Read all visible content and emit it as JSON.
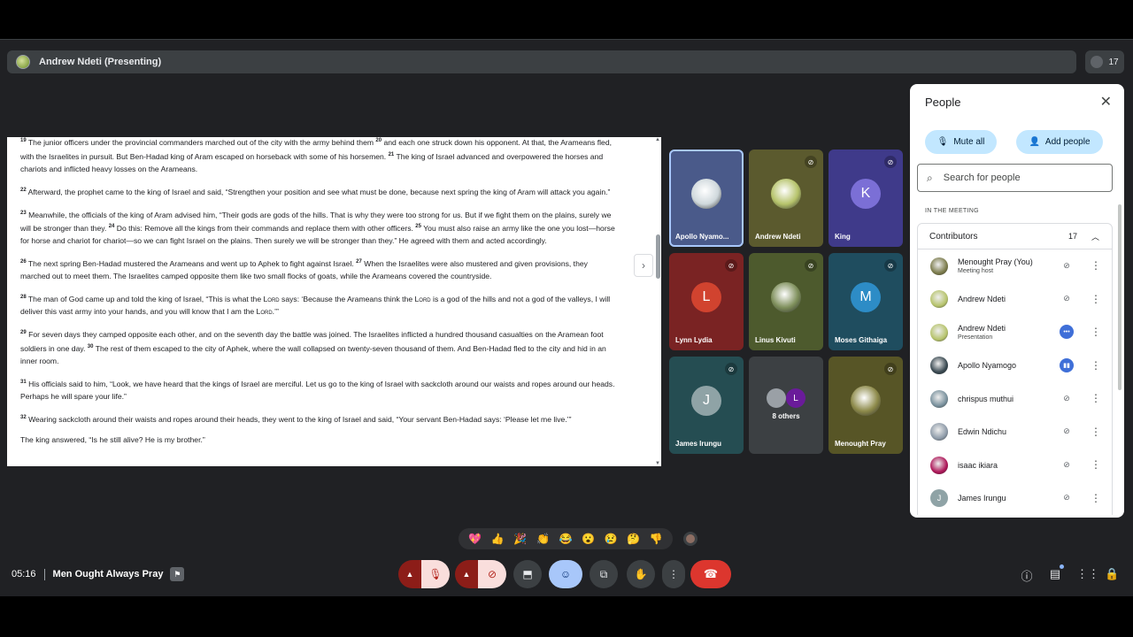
{
  "header": {
    "presenting_label": "Andrew Ndeti (Presenting)",
    "participant_count": "17"
  },
  "document": {
    "paragraphs": [
      {
        "html": "<sup>19</sup> The junior officers under the provincial commanders marched out of the city with the army behind them <sup>20</sup> and each one struck down his opponent. At that, the Arameans fled, with the Israelites in pursuit. But Ben-Hadad king of Aram escaped on horseback with some of his horsemen. <sup>21</sup> The king of Israel advanced and overpowered the horses and chariots and inflicted heavy losses on the Arameans."
      },
      {
        "html": "<sup>22</sup> Afterward, the prophet came to the king of Israel and said, “Strengthen your position and see what must be done, because next spring the king of Aram will attack you again.”"
      },
      {
        "html": "<sup>23</sup> Meanwhile, the officials of the king of Aram advised him, “Their gods are gods of the hills. That is why they were too strong for us. But if we fight them on the plains, surely we will be stronger than they. <sup>24</sup> Do this: Remove all the kings from their commands and replace them with other officers. <sup>25</sup> You must also raise an army like the one you lost—horse for horse and chariot for chariot—so we can fight Israel on the plains. Then surely we will be stronger than they.” He agreed with them and acted accordingly."
      },
      {
        "html": "<sup>26</sup> The next spring Ben-Hadad mustered the Arameans and went up to Aphek to fight against Israel. <sup>27</sup> When the Israelites were also mustered and given provisions, they marched out to meet them. The Israelites camped opposite them like two small flocks of goats, while the Arameans covered the countryside."
      },
      {
        "html": "<sup>28</sup> The man of God came up and told the king of Israel, “This is what the <span class=\"sc\">Lord</span> says: ‘Because the Arameans think the <span class=\"sc\">Lord</span> is a god of the hills and not a god of the valleys, I will deliver this vast army into your hands, and you will know that I am the <span class=\"sc\">Lord</span>.’”"
      },
      {
        "html": "<sup>29</sup> For seven days they camped opposite each other, and on the seventh day the battle was joined. The Israelites inflicted a hundred thousand casualties on the Aramean foot soldiers in one day. <sup>30</sup> The rest of them escaped to the city of Aphek, where the wall collapsed on twenty-seven thousand of them. And Ben-Hadad fled to the city and hid in an inner room."
      },
      {
        "html": "<sup>31</sup> His officials said to him, “Look, we have heard that the kings of Israel are merciful. Let us go to the king of Israel with sackcloth around our waists and ropes around our heads. Perhaps he will spare your life.”"
      },
      {
        "html": "<sup>32</sup> Wearing sackcloth around their waists and ropes around their heads, they went to the king of Israel and said, “Your servant Ben-Hadad says: ‘Please let me live.’”"
      },
      {
        "html": "The king answered, “Is he still alive? He is my brother.”"
      }
    ]
  },
  "tiles": [
    {
      "name": "Apollo Nyamo...",
      "letter": "",
      "bg": "#4a5a8a",
      "avatar_color": "#cfd8dc",
      "muted": false,
      "photo": true,
      "selected": true
    },
    {
      "name": "Andrew Ndeti",
      "letter": "",
      "bg": "#5b5a2e",
      "avatar_color": "#b6c36b",
      "muted": true,
      "photo": true,
      "selected": false
    },
    {
      "name": "King",
      "letter": "K",
      "bg": "#3f3a8a",
      "avatar_color": "#7b6fd6",
      "muted": true,
      "photo": false,
      "selected": false
    },
    {
      "name": "Lynn Lydia",
      "letter": "L",
      "bg": "#7a2323",
      "avatar_color": "#d1432f",
      "muted": true,
      "photo": false,
      "selected": false
    },
    {
      "name": "Linus Kivuti",
      "letter": "",
      "bg": "#4d5a2d",
      "avatar_color": "#7e8f5b",
      "muted": true,
      "photo": true,
      "selected": false
    },
    {
      "name": "Moses Githaiga",
      "letter": "M",
      "bg": "#1f4d5f",
      "avatar_color": "#2d8cc6",
      "muted": true,
      "photo": false,
      "selected": false
    },
    {
      "name": "James Irungu",
      "letter": "J",
      "bg": "#254d52",
      "avatar_color": "#8fa3a6",
      "muted": true,
      "photo": false,
      "selected": false
    },
    {
      "name": "8 others",
      "letter": "",
      "bg": "#3c4043",
      "avatar_color": "#6a1b9a",
      "muted": false,
      "photo": false,
      "selected": false
    },
    {
      "name": "Menought Pray",
      "letter": "",
      "bg": "#575526",
      "avatar_color": "#8d8a4a",
      "muted": true,
      "photo": true,
      "selected": false
    }
  ],
  "people_panel": {
    "title": "People",
    "mute_all": "Mute all",
    "add_people": "Add people",
    "search_placeholder": "Search for people",
    "section_label": "IN THE MEETING",
    "contributors_label": "Contributors",
    "contributors_count": "17",
    "participants": [
      {
        "name": "Menought Pray (You)",
        "sub": "Meeting host",
        "avatar": "#7a7a4a",
        "letter": "",
        "mic": "muted"
      },
      {
        "name": "Andrew Ndeti",
        "sub": "",
        "avatar": "#b6c36b",
        "letter": "",
        "mic": "muted"
      },
      {
        "name": "Andrew Ndeti",
        "sub": "Presentation",
        "avatar": "#b6c36b",
        "letter": "",
        "mic": "more"
      },
      {
        "name": "Apollo Nyamogo",
        "sub": "",
        "avatar": "#37474f",
        "letter": "",
        "mic": "speaking"
      },
      {
        "name": "chrispus muthui",
        "sub": "",
        "avatar": "#78909c",
        "letter": "",
        "mic": "muted"
      },
      {
        "name": "Edwin Ndichu",
        "sub": "",
        "avatar": "#8d9aa8",
        "letter": "",
        "mic": "muted"
      },
      {
        "name": "isaac ikiara",
        "sub": "",
        "avatar": "#ad1457",
        "letter": "",
        "mic": "muted"
      },
      {
        "name": "James Irungu",
        "sub": "",
        "avatar": "#8fa3a6",
        "letter": "J",
        "mic": "muted"
      }
    ]
  },
  "reactions": [
    "💖",
    "👍",
    "🎉",
    "👏",
    "😂",
    "😮",
    "😢",
    "🤔",
    "👎"
  ],
  "footer": {
    "time": "05:16",
    "meeting_name": "Men Ought Always Pray"
  }
}
